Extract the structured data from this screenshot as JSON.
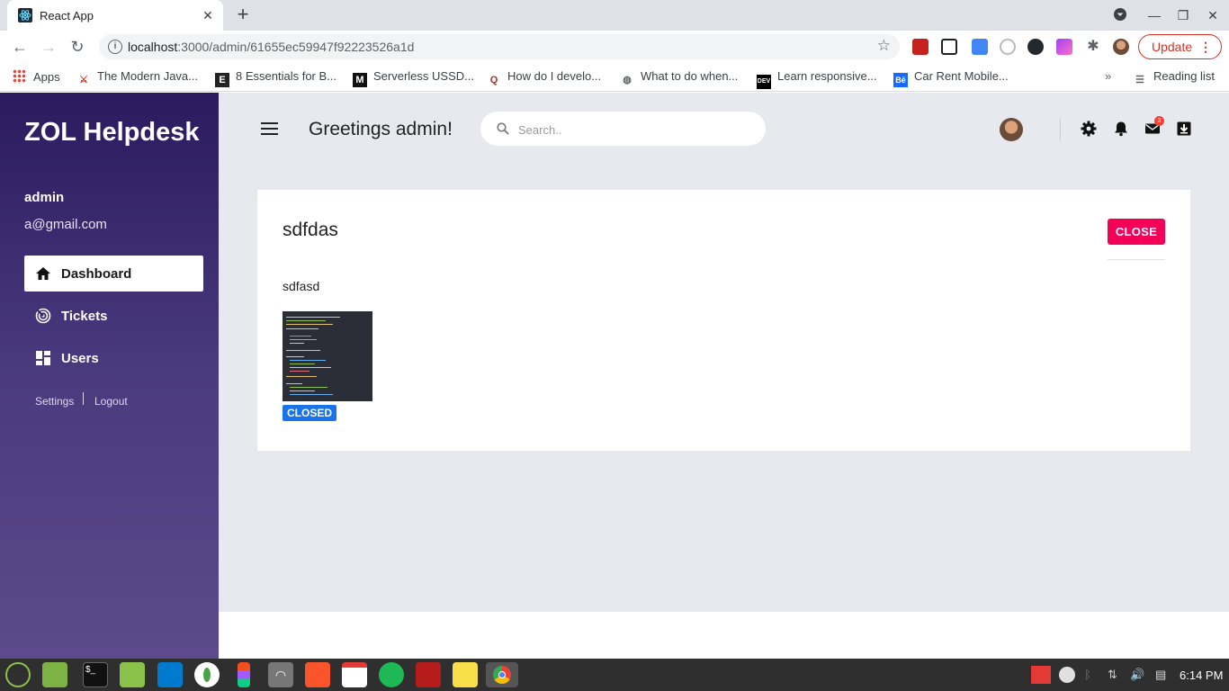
{
  "browser": {
    "tab_title": "React App",
    "url_host": "localhost",
    "url_path": ":3000/admin/61655ec59947f92223526a1d",
    "update_label": "Update",
    "bookmarks": [
      {
        "icon": "apps-grid-icon",
        "label": "Apps"
      },
      {
        "icon": "ninja-icon",
        "label": "The Modern Java..."
      },
      {
        "icon": "e-logo-icon",
        "label": "8 Essentials for B..."
      },
      {
        "icon": "medium-icon",
        "label": "Serverless USSD..."
      },
      {
        "icon": "quora-icon",
        "label": "How do I develo..."
      },
      {
        "icon": "globe-icon",
        "label": "What to do when..."
      },
      {
        "icon": "dev-icon",
        "label": "Learn responsive..."
      },
      {
        "icon": "behance-icon",
        "label": "Car Rent Mobile..."
      }
    ],
    "reading_list": "Reading list"
  },
  "app": {
    "brand": "ZOL Helpdesk",
    "user": {
      "name": "admin",
      "email": "a@gmail.com"
    },
    "nav": [
      {
        "label": "Dashboard",
        "icon": "home-icon",
        "active": true
      },
      {
        "label": "Tickets",
        "icon": "radar-icon",
        "active": false
      },
      {
        "label": "Users",
        "icon": "dashboard-grid-icon",
        "active": false
      }
    ],
    "footer_links": {
      "settings": "Settings",
      "logout": "Logout"
    },
    "header": {
      "greeting": "Greetings admin!",
      "search_placeholder": "Search..",
      "mail_badge": "3"
    },
    "ticket": {
      "title": "sdfdas",
      "description": "sdfasd",
      "close_label": "CLOSE",
      "status": "CLOSED"
    },
    "colors": {
      "accent": "#f50057",
      "status": "#1a73e8",
      "sidebar_top": "#2b1a5e",
      "sidebar_bottom": "#5d4a8c"
    }
  },
  "taskbar": {
    "clock": "6:14 PM"
  }
}
